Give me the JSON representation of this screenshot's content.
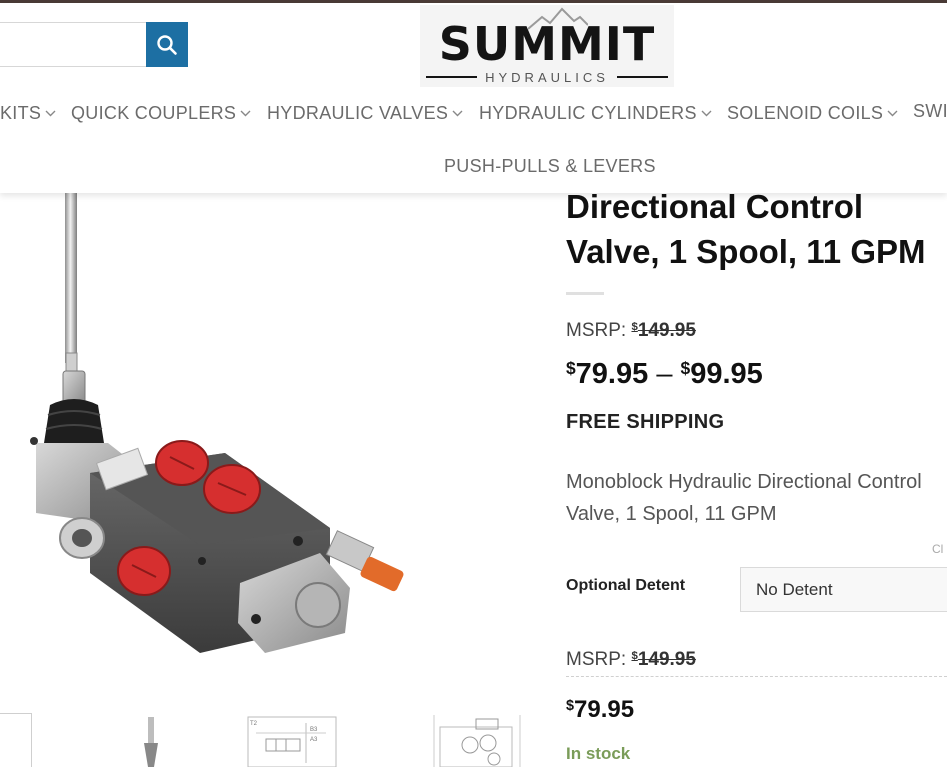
{
  "header": {
    "search": {
      "placeholder": "",
      "value": ""
    },
    "logo": {
      "word": "SUMMIT",
      "sub": "HYDRAULICS"
    },
    "nav": [
      {
        "label": "KITS"
      },
      {
        "label": "QUICK COUPLERS"
      },
      {
        "label": "HYDRAULIC VALVES"
      },
      {
        "label": "HYDRAULIC CYLINDERS"
      },
      {
        "label": "SOLENOID COILS"
      },
      {
        "label": "SWI"
      }
    ],
    "nav_row2": {
      "label": "PUSH-PULLS & LEVERS"
    }
  },
  "product": {
    "title_line1": "Directional Control",
    "title_line2": "Valve, 1 Spool, 11 GPM",
    "msrp_label": "MSRP:",
    "currency": "$",
    "msrp_value": "149.95",
    "price_low": "79.95",
    "price_sep": "–",
    "price_high": "99.95",
    "free_shipping": "FREE SHIPPING",
    "description": "Monoblock Hydraulic Directional Control Valve, 1 Spool, 11 GPM",
    "clear_label": "Cl",
    "option": {
      "label": "Optional Detent",
      "selected": "No Detent"
    },
    "variation": {
      "msrp_label": "MSRP:",
      "msrp_value": "149.95",
      "price": "79.95",
      "stock": "In stock"
    }
  },
  "colors": {
    "accent": "#1d6fa3",
    "topbar": "#4a3b36",
    "in_stock": "#7a9c59",
    "nav_text": "#6b6b6b"
  },
  "icons": [
    "search-icon",
    "chevron-down-icon",
    "mountain-logo-icon"
  ]
}
